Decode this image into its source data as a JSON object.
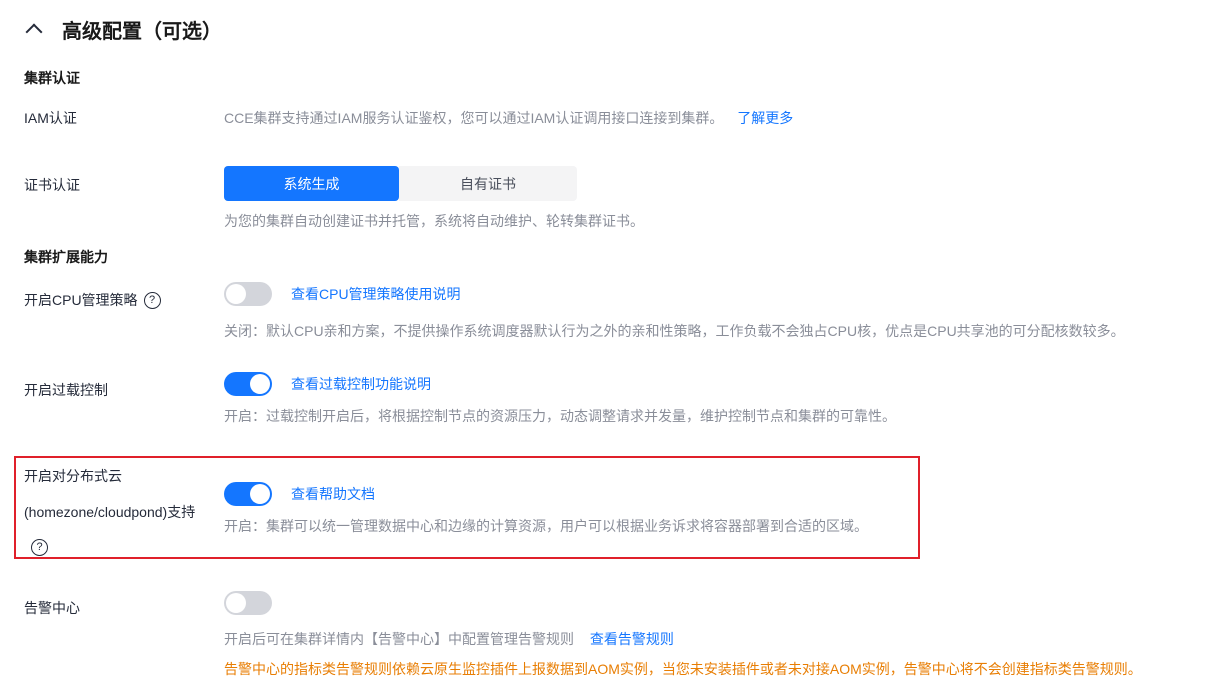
{
  "header": {
    "title": "高级配置（可选）"
  },
  "auth": {
    "group_title": "集群认证",
    "iam": {
      "label": "IAM认证",
      "desc": "CCE集群支持通过IAM服务认证鉴权，您可以通过IAM认证调用接口连接到集群。",
      "link": "了解更多"
    },
    "cert": {
      "label": "证书认证",
      "options": [
        "系统生成",
        "自有证书"
      ],
      "selected": "系统生成",
      "desc": "为您的集群自动创建证书并托管，系统将自动维护、轮转集群证书。"
    }
  },
  "ext": {
    "group_title": "集群扩展能力",
    "cpu": {
      "label": "开启CPU管理策略",
      "enabled": false,
      "link": "查看CPU管理策略使用说明",
      "desc": "关闭：默认CPU亲和方案，不提供操作系统调度器默认行为之外的亲和性策略，工作负载不会独占CPU核，优点是CPU共享池的可分配核数较多。"
    },
    "overload": {
      "label": "开启过载控制",
      "enabled": true,
      "link": "查看过载控制功能说明",
      "desc": "开启：过载控制开启后，将根据控制节点的资源压力，动态调整请求并发量，维护控制节点和集群的可靠性。"
    },
    "distributed": {
      "label_line1": "开启对分布式云",
      "label_line2": "(homezone/cloudpond)支持",
      "enabled": true,
      "link": "查看帮助文档",
      "desc": "开启：集群可以统一管理数据中心和边缘的计算资源，用户可以根据业务诉求将容器部署到合适的区域。"
    },
    "alarm": {
      "label": "告警中心",
      "enabled": false,
      "desc": "开启后可在集群详情内【告警中心】中配置管理告警规则",
      "link": "查看告警规则",
      "warning": "告警中心的指标类告警规则依赖云原生监控插件上报数据到AOM实例，当您未安装插件或者未对接AOM实例，告警中心将不会创建指标类告警规则。"
    }
  },
  "icons": {
    "help": "?"
  },
  "colors": {
    "primary": "#1476ff",
    "warning": "#e87e04",
    "highlight": "#e0202a"
  }
}
